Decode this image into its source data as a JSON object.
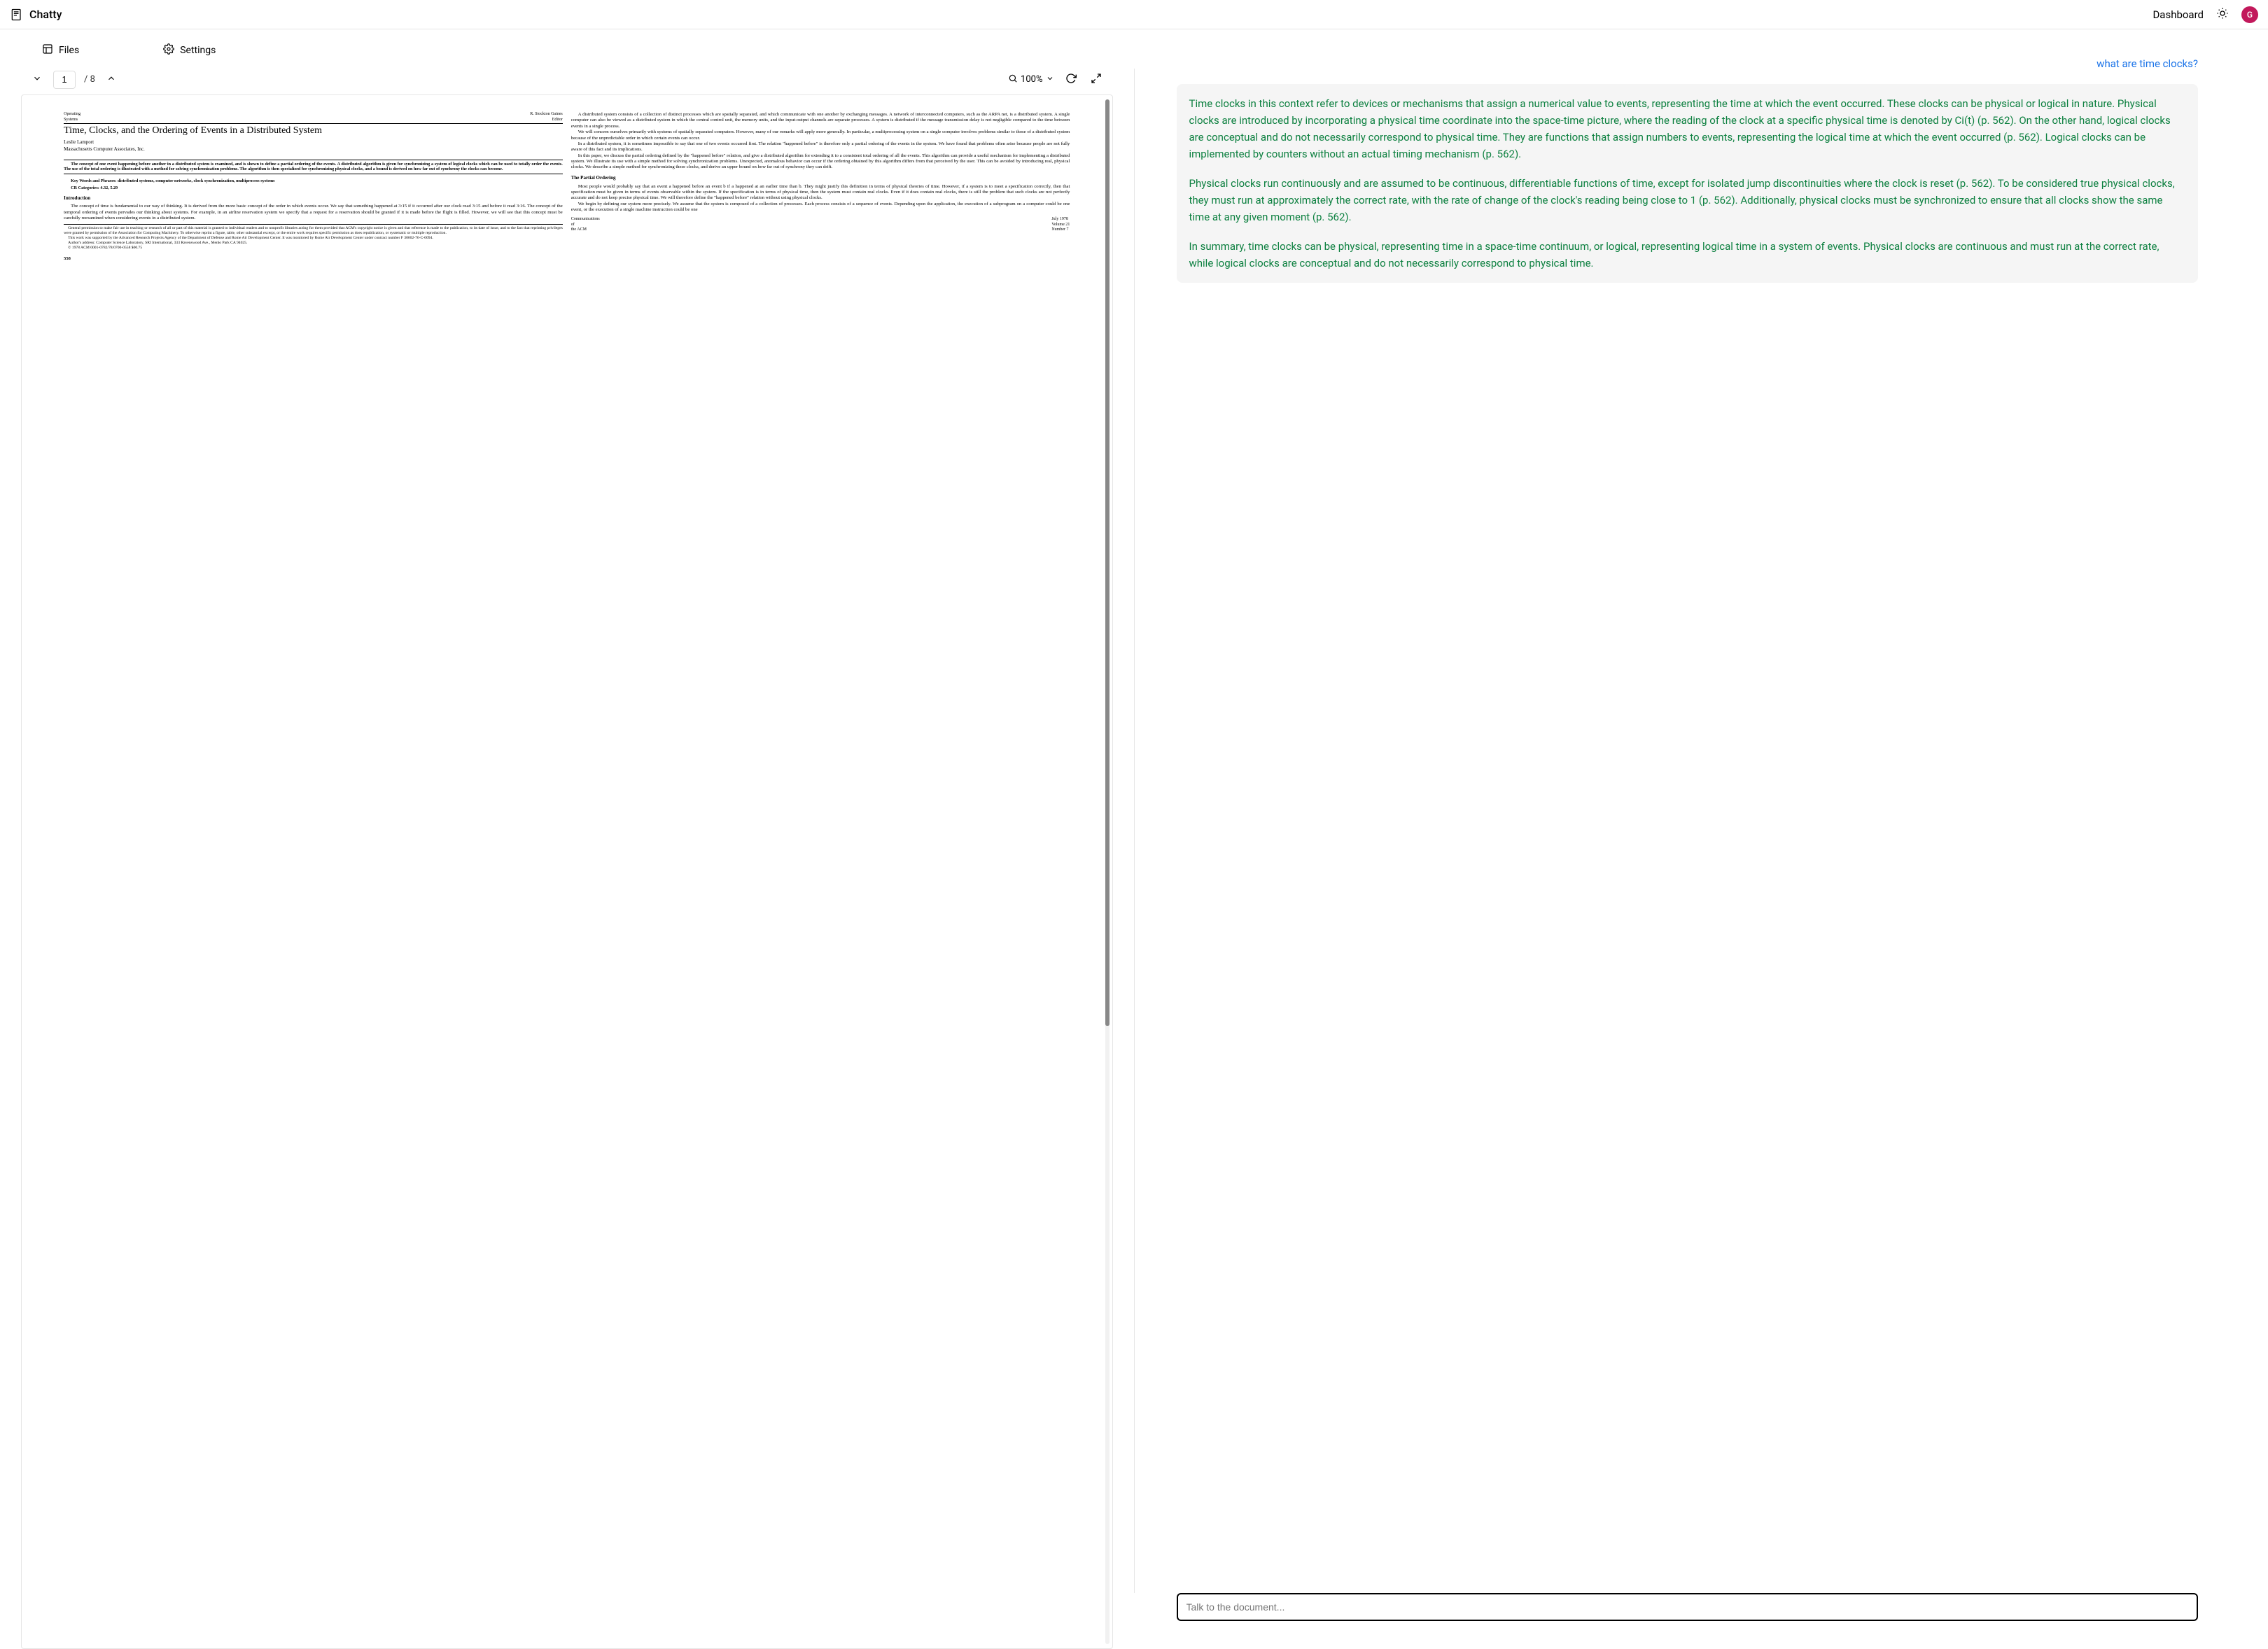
{
  "header": {
    "brand": "Chatty",
    "dashboard": "Dashboard",
    "avatar_initial": "G"
  },
  "tabs": {
    "files": "Files",
    "settings": "Settings"
  },
  "toolbar": {
    "page_current": "1",
    "page_total": "/ 8",
    "zoom": "100%"
  },
  "document": {
    "hdr_left_1": "Operating",
    "hdr_left_2": "Systems",
    "hdr_right_1": "R. Stockton Gaines",
    "hdr_right_2": "Editor",
    "title": "Time, Clocks, and the Ordering of Events in a Distributed System",
    "author": "Leslie Lamport",
    "affiliation": "Massachusetts Computer Associates, Inc.",
    "abstract": "The concept of one event happening before another in a distributed system is examined, and is shown to define a partial ordering of the events. A distributed algorithm is given for synchronizing a system of logical clocks which can be used to totally order the events. The use of the total ordering is illustrated with a method for solving synchronization problems. The algorithm is then specialized for synchronizing physical clocks, and a bound is derived on how far out of synchrony the clocks can become.",
    "keywords": "Key Words and Phrases: distributed systems, computer networks, clock synchronization, multiprocess systems",
    "cr": "CR Categories: 4.32, 5.29",
    "sec_intro": "Introduction",
    "intro_p1": "The concept of time is fundamental to our way of thinking. It is derived from the more basic concept of the order in which events occur. We say that something happened at 3:15 if it occurred after our clock read 3:15 and before it read 3:16. The concept of the temporal ordering of events pervades our thinking about systems. For example, in an airline reservation system we specify that a request for a reservation should be granted if it is made before the flight is filled. However, we will see that this concept must be carefully reexamined when considering events in a distributed system.",
    "fn1": "General permission to make fair use in teaching or research of all or part of this material is granted to individual readers and to nonprofit libraries acting for them provided that ACM's copyright notice is given and that reference is made to the publication, to its date of issue, and to the fact that reprinting privileges were granted by permission of the Association for Computing Machinery. To otherwise reprint a figure, table, other substantial excerpt, or the entire work requires specific permission as does republication, or systematic or multiple reproduction.",
    "fn2": "This work was supported by the Advanced Research Projects Agency of the Department of Defense and Rome Air Development Center. It was monitored by Rome Air Development Center under contract number F 30602-76-C-0094.",
    "fn3": "Author's address: Computer Science Laboratory, SRI International, 333 Ravenswood Ave., Menlo Park CA 94025.",
    "fn4": "© 1978 ACM 0001-0782/78/0700-0558 $00.75",
    "page_num": "558",
    "col2_p1": "A distributed system consists of a collection of distinct processes which are spatially separated, and which communicate with one another by exchanging messages. A network of interconnected computers, such as the ARPA net, is a distributed system. A single computer can also be viewed as a distributed system in which the central control unit, the memory units, and the input-output channels are separate processes. A system is distributed if the message transmission delay is not negligible compared to the time between events in a single process.",
    "col2_p2": "We will concern ourselves primarily with systems of spatially separated computers. However, many of our remarks will apply more generally. In particular, a multiprocessing system on a single computer involves problems similar to those of a distributed system because of the unpredictable order in which certain events can occur.",
    "col2_p3": "In a distributed system, it is sometimes impossible to say that one of two events occurred first. The relation \"happened before\" is therefore only a partial ordering of the events in the system. We have found that problems often arise because people are not fully aware of this fact and its implications.",
    "col2_p4": "In this paper, we discuss the partial ordering defined by the \"happened before\" relation, and give a distributed algorithm for extending it to a consistent total ordering of all the events. This algorithm can provide a useful mechanism for implementing a distributed system. We illustrate its use with a simple method for solving synchronization problems. Unexpected, anomalous behavior can occur if the ordering obtained by this algorithm differs from that perceived by the user. This can be avoided by introducing real, physical clocks. We describe a simple method for synchronizing these clocks, and derive an upper bound on how far out of synchrony they can drift.",
    "sec_partial": "The Partial Ordering",
    "col2_p5": "Most people would probably say that an event a happened before an event b if a happened at an earlier time than b. They might justify this definition in terms of physical theories of time. However, if a system is to meet a specification correctly, then that specification must be given in terms of events observable within the system. If the specification is in terms of physical time, then the system must contain real clocks. Even if it does contain real clocks, there is still the problem that such clocks are not perfectly accurate and do not keep precise physical time. We will therefore define the \"happened before\" relation without using physical clocks.",
    "col2_p6": "We begin by defining our system more precisely. We assume that the system is composed of a collection of processes. Each process consists of a sequence of events. Depending upon the application, the execution of a subprogram on a computer could be one event, or the execution of a single machine instruction could be one",
    "foot_l1": "Communications",
    "foot_l2": "of",
    "foot_l3": "the ACM",
    "foot_r1": "July 1978",
    "foot_r2": "Volume 21",
    "foot_r3": "Number 7"
  },
  "chat": {
    "user": "what are time clocks?",
    "assistant_p1": "Time clocks in this context refer to devices or mechanisms that assign a numerical value to events, representing the time at which the event occurred. These clocks can be physical or logical in nature. Physical clocks are introduced by incorporating a physical time coordinate into the space-time picture, where the reading of the clock at a specific physical time is denoted by Ci(t) (p. 562). On the other hand, logical clocks are conceptual and do not necessarily correspond to physical time. They are functions that assign numbers to events, representing the logical time at which the event occurred (p. 562). Logical clocks can be implemented by counters without an actual timing mechanism (p. 562).",
    "assistant_p2": "Physical clocks run continuously and are assumed to be continuous, differentiable functions of time, except for isolated jump discontinuities where the clock is reset (p. 562). To be considered true physical clocks, they must run at approximately the correct rate, with the rate of change of the clock's reading being close to 1 (p. 562). Additionally, physical clocks must be synchronized to ensure that all clocks show the same time at any given moment (p. 562).",
    "assistant_p3": "In summary, time clocks can be physical, representing time in a space-time continuum, or logical, representing logical time in a system of events. Physical clocks are continuous and must run at the correct rate, while logical clocks are conceptual and do not necessarily correspond to physical time.",
    "input_placeholder": "Talk to the document..."
  }
}
